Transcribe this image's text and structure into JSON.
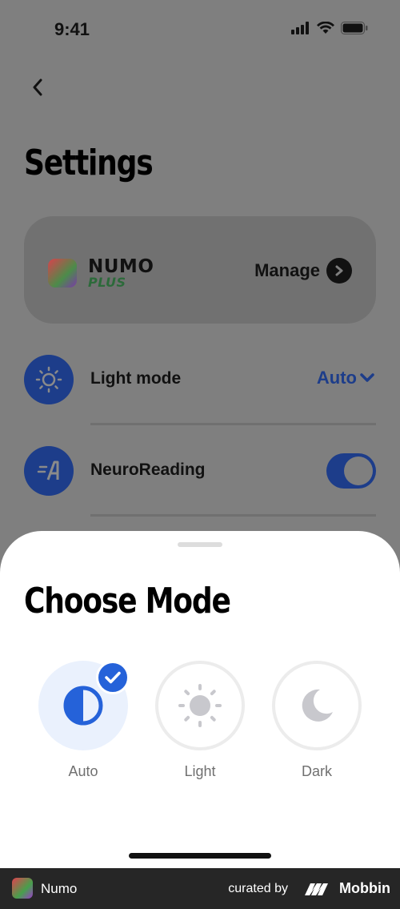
{
  "status_bar": {
    "time": "9:41"
  },
  "header": {
    "title": "Settings"
  },
  "plus_card": {
    "brand_top": "NUMO",
    "brand_bottom": "PLUS",
    "manage_label": "Manage"
  },
  "settings": {
    "light_mode": {
      "label": "Light mode",
      "value": "Auto"
    },
    "neuro_reading": {
      "label": "NeuroReading",
      "enabled": true
    }
  },
  "sheet": {
    "title": "Choose Mode",
    "options": [
      {
        "label": "Auto",
        "icon": "half-circle-icon",
        "selected": true
      },
      {
        "label": "Light",
        "icon": "sun-icon",
        "selected": false
      },
      {
        "label": "Dark",
        "icon": "moon-icon",
        "selected": false
      }
    ]
  },
  "footer": {
    "app_name": "Numo",
    "curated_by": "curated by",
    "brand": "Mobbin"
  },
  "colors": {
    "accent": "#2562d9",
    "navy": "#1d3d8a",
    "overlay": "#7f7f7f"
  }
}
